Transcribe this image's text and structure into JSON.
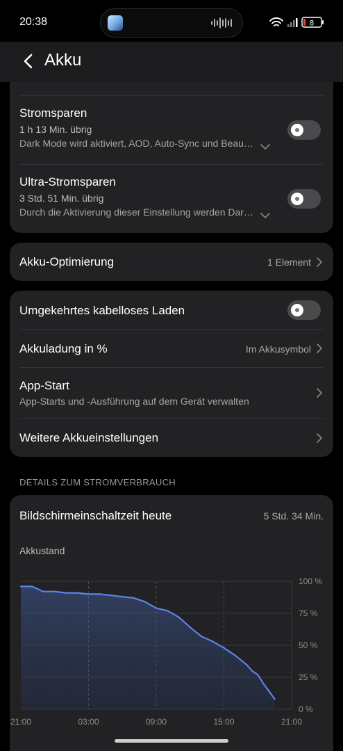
{
  "status": {
    "time": "20:38",
    "battery": "8"
  },
  "header": {
    "title": "Akku"
  },
  "card1": {
    "stromsparen": {
      "title": "Stromsparen",
      "remaining": "1 h 13 Min. übrig",
      "description": "Dark Mode wird aktiviert, AOD, Auto-Sync und Beau…",
      "enabled": false
    },
    "ultra": {
      "title": "Ultra-Stromsparen",
      "remaining": "3 Std. 51 Min. übrig",
      "description": "Durch die Aktivierung dieser Einstellung werden Dar…",
      "enabled": false
    }
  },
  "optimization": {
    "title": "Akku-Optimierung",
    "value": "1 Element"
  },
  "card3": {
    "reverse_charging": {
      "title": "Umgekehrtes kabelloses Laden",
      "enabled": false
    },
    "percentage": {
      "title": "Akkuladung in %",
      "value": "Im Akkusymbol"
    },
    "app_start": {
      "title": "App-Start",
      "description": "App-Starts und -Ausführung auf dem Gerät verwalten"
    },
    "more": {
      "title": "Weitere Akkueinstellungen"
    }
  },
  "details": {
    "section_title": "DETAILS ZUM STROMVERBRAUCH",
    "screen_time_label": "Bildschirmeinschaltzeit heute",
    "screen_time_value": "5 Std. 34 Min.",
    "chart_label": "Akkustand"
  },
  "chart_data": {
    "type": "area",
    "x_labels": [
      "21:00",
      "03:00",
      "09:00",
      "15:00",
      "21:00"
    ],
    "y_labels": [
      "100 %",
      "75 %",
      "50 %",
      "25 %",
      "0 %"
    ],
    "ylim": [
      0,
      100
    ],
    "grid": true,
    "series": [
      {
        "x_hours": [
          0,
          1,
          2,
          3,
          4,
          5,
          6,
          7,
          8,
          9,
          10,
          11,
          12,
          13,
          14,
          15,
          16,
          17,
          18,
          19,
          20,
          20.5,
          21,
          21.5,
          22,
          22.5
        ],
        "values": [
          96,
          96,
          92,
          92,
          91,
          91,
          90,
          90,
          89,
          88,
          87,
          84,
          79,
          77,
          72,
          64,
          57,
          53,
          48,
          42,
          35,
          30,
          27,
          20,
          14,
          8
        ]
      }
    ],
    "color": "#5b83e8"
  }
}
